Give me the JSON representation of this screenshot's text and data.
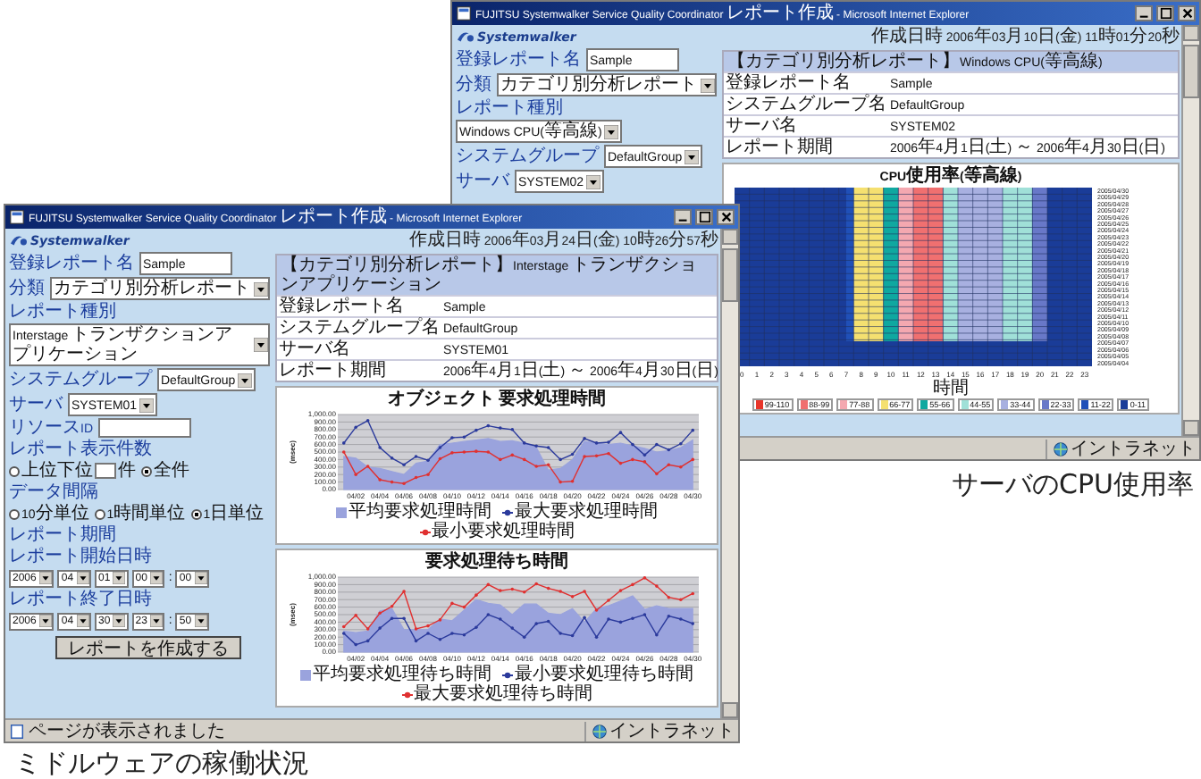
{
  "cpu_report_window": {
    "title": "FUJITSU Systemwalker Service Quality Coordinator レポート作成 - Microsoft Internet Explorer",
    "logo": "Systemwalker",
    "created": "作成日時 2006年03月10日(金) 11時01分20秒",
    "form": [
      {
        "kind": "label",
        "text": "登録レポート名"
      },
      {
        "kind": "field",
        "value": "Sample"
      },
      {
        "kind": "label",
        "text": "分類"
      },
      {
        "kind": "select",
        "value": "カテゴリ別分析レポート"
      },
      {
        "kind": "label",
        "text": "レポート種別"
      },
      {
        "kind": "select",
        "value": "Windows CPU(等高線)"
      },
      {
        "kind": "label",
        "text": "システムグループ"
      },
      {
        "kind": "select",
        "value": "DefaultGroup"
      },
      {
        "kind": "label",
        "text": "サーバ"
      },
      {
        "kind": "select",
        "value": "SYSTEM02"
      }
    ],
    "report_header": "【カテゴリ別分析レポート】Windows CPU(等高線)",
    "info_rows": [
      {
        "name": "登録レポート名",
        "value": "Sample"
      },
      {
        "name": "システムグループ名",
        "value": "DefaultGroup"
      },
      {
        "name": "サーバ名",
        "value": "SYSTEM02"
      },
      {
        "name": "レポート期間",
        "value": "2006年4月1日(土) ～ 2006年4月30日(日)"
      }
    ],
    "cpu_chart": {
      "title": "CPU使用率(等高線)",
      "xlabel": "時間",
      "x_labels": [
        "0",
        "1",
        "2",
        "3",
        "4",
        "5",
        "6",
        "7",
        "8",
        "9",
        "10",
        "11",
        "12",
        "13",
        "14",
        "15",
        "16",
        "17",
        "18",
        "19",
        "20",
        "21",
        "22",
        "23"
      ],
      "y_labels": [
        "2005/04/30",
        "2005/04/29",
        "2005/04/28",
        "2005/04/27",
        "2005/04/26",
        "2005/04/25",
        "2005/04/24",
        "2005/04/23",
        "2005/04/22",
        "2005/04/21",
        "2005/04/20",
        "2005/04/19",
        "2005/04/18",
        "2005/04/17",
        "2005/04/16",
        "2005/04/15",
        "2005/04/14",
        "2005/04/13",
        "2005/04/12",
        "2005/04/11",
        "2005/04/10",
        "2005/04/09",
        "2005/04/08",
        "2005/04/07",
        "2005/04/06",
        "2005/04/05",
        "2005/04/04"
      ],
      "legend": [
        {
          "label": "99-110",
          "color": "#e8352a"
        },
        {
          "label": "88-99",
          "color": "#f07070"
        },
        {
          "label": "77-88",
          "color": "#f4a8b0"
        },
        {
          "label": "66-77",
          "color": "#f5e070"
        },
        {
          "label": "55-66",
          "color": "#10a8a0"
        },
        {
          "label": "44-55",
          "color": "#a0e0d8"
        },
        {
          "label": "33-44",
          "color": "#a8b0e0"
        },
        {
          "label": "22-33",
          "color": "#6878c8"
        },
        {
          "label": "11-22",
          "color": "#2050b8"
        },
        {
          "label": "0-11",
          "color": "#1a3c98"
        }
      ]
    },
    "status": {
      "zone": "イントラネット"
    }
  },
  "middleware_report_window": {
    "title": "FUJITSU Systemwalker Service Quality Coordinator レポート作成 - Microsoft Internet Explorer",
    "logo": "Systemwalker",
    "created": "作成日時 2006年03月24日(金) 10時26分57秒",
    "form": [
      {
        "kind": "label",
        "text": "登録レポート名"
      },
      {
        "kind": "field",
        "value": "Sample"
      },
      {
        "kind": "label",
        "text": "分類"
      },
      {
        "kind": "select",
        "value": "カテゴリ別分析レポート"
      },
      {
        "kind": "label",
        "text": "レポート種別"
      },
      {
        "kind": "select",
        "value": "Interstage トランザクションアプリケーション"
      },
      {
        "kind": "label",
        "text": "システムグループ"
      },
      {
        "kind": "select",
        "value": "DefaultGroup"
      },
      {
        "kind": "label",
        "text": "サーバ"
      },
      {
        "kind": "select",
        "value": "SYSTEM01"
      },
      {
        "kind": "label",
        "text": "リソースID"
      },
      {
        "kind": "field"
      },
      {
        "kind": "label",
        "text": "レポート表示件数"
      },
      {
        "kind": "radio_group",
        "options": [
          {
            "label": "上位下位",
            "selected": false,
            "unit": "件"
          },
          {
            "label": "全件",
            "selected": true
          }
        ]
      },
      {
        "kind": "label",
        "text": "データ間隔"
      },
      {
        "kind": "radio_group",
        "options": [
          {
            "label": "10分単位",
            "selected": false
          },
          {
            "label": "1時間単位",
            "selected": false
          },
          {
            "label": "1日単位",
            "selected": true
          }
        ]
      },
      {
        "kind": "label",
        "text": "レポート期間"
      },
      {
        "kind": "label",
        "text": "レポート開始日時"
      },
      {
        "kind": "datetime",
        "parts": [
          "2006",
          "04",
          "01",
          "00",
          "00"
        ],
        "separator": ":"
      },
      {
        "kind": "label",
        "text": "レポート終了日時"
      },
      {
        "kind": "datetime",
        "parts": [
          "2006",
          "04",
          "30",
          "23",
          "50"
        ],
        "separator": ":"
      },
      {
        "kind": "button",
        "text": "レポートを作成する"
      }
    ],
    "report_header": "【カテゴリ別分析レポート】Interstage トランザクションアプリケーション",
    "info_rows": [
      {
        "name": "登録レポート名",
        "value": "Sample"
      },
      {
        "name": "システムグループ名",
        "value": "DefaultGroup"
      },
      {
        "name": "サーバ名",
        "value": "SYSTEM01"
      },
      {
        "name": "レポート期間",
        "value": "2006年4月1日(土) ～ 2006年4月30日(日)"
      }
    ],
    "charts": [
      {
        "chart_data": {
          "type": "line",
          "title": "オブジェクト 要求処理時間",
          "ylabel": "(msec)",
          "ylim": [
            0,
            1000
          ],
          "grid": true,
          "legend": "bottom",
          "yticks": [
            {
              "value": 0,
              "label": "0.00"
            },
            {
              "value": 100,
              "label": "100.00"
            },
            {
              "value": 200,
              "label": "200.00"
            },
            {
              "value": 300,
              "label": "300.00"
            },
            {
              "value": 400,
              "label": "400.00"
            },
            {
              "value": 500,
              "label": "500.00"
            },
            {
              "value": 600,
              "label": "600.00"
            },
            {
              "value": 700,
              "label": "700.00"
            },
            {
              "value": 800,
              "label": "800.00"
            },
            {
              "value": 900,
              "label": "900.00"
            },
            {
              "value": 1000,
              "label": "1,000.00"
            }
          ],
          "categories": [
            null,
            "04/02",
            null,
            "04/04",
            null,
            "04/06",
            null,
            "04/08",
            null,
            "04/10",
            null,
            "04/12",
            null,
            "04/14",
            null,
            "04/16",
            null,
            "04/18",
            null,
            "04/20",
            null,
            "04/22",
            null,
            "04/24",
            null,
            "04/26",
            null,
            "04/28",
            null,
            "04/30"
          ],
          "series": [
            {
              "name": "平均要求処理時間",
              "type": "area",
              "color": "#9aa3dd",
              "values": [
                440,
                420,
                300,
                280,
                240,
                200,
                350,
                380,
                600,
                620,
                640,
                660,
                680,
                640,
                650,
                620,
                560,
                260,
                280,
                400,
                640,
                620,
                600,
                620,
                580,
                550,
                500,
                520,
                560,
                660
              ]
            },
            {
              "name": "最大要求処理時間",
              "type": "line",
              "color": "#2b3a9c",
              "values": [
                620,
                830,
                920,
                560,
                420,
                330,
                440,
                390,
                560,
                690,
                700,
                790,
                850,
                820,
                800,
                620,
                580,
                560,
                400,
                470,
                680,
                620,
                630,
                760,
                600,
                460,
                600,
                530,
                610,
                790
              ]
            },
            {
              "name": "最小要求処理時間",
              "type": "line",
              "color": "#e03030",
              "values": [
                500,
                200,
                310,
                130,
                100,
                80,
                160,
                200,
                410,
                490,
                500,
                510,
                500,
                400,
                460,
                400,
                310,
                330,
                100,
                110,
                440,
                450,
                480,
                350,
                400,
                370,
                210,
                330,
                300,
                400
              ]
            }
          ]
        }
      },
      {
        "chart_data": {
          "type": "line",
          "title": "要求処理待ち時間",
          "ylabel": "(msec)",
          "ylim": [
            0,
            1000
          ],
          "grid": true,
          "legend": "bottom",
          "yticks": [
            {
              "value": 0,
              "label": "0.00"
            },
            {
              "value": 100,
              "label": "100.00"
            },
            {
              "value": 200,
              "label": "200.00"
            },
            {
              "value": 300,
              "label": "300.00"
            },
            {
              "value": 400,
              "label": "400.00"
            },
            {
              "value": 500,
              "label": "500.00"
            },
            {
              "value": 600,
              "label": "600.00"
            },
            {
              "value": 700,
              "label": "700.00"
            },
            {
              "value": 800,
              "label": "800.00"
            },
            {
              "value": 900,
              "label": "900.00"
            },
            {
              "value": 1000,
              "label": "1,000.00"
            }
          ],
          "categories": [
            null,
            "04/02",
            null,
            "04/04",
            null,
            "04/06",
            null,
            "04/08",
            null,
            "04/10",
            null,
            "04/12",
            null,
            "04/14",
            null,
            "04/16",
            null,
            "04/18",
            null,
            "04/20",
            null,
            "04/22",
            null,
            "04/24",
            null,
            "04/26",
            null,
            "04/28",
            null,
            "04/30"
          ],
          "series": [
            {
              "name": "平均要求処理待ち時間",
              "type": "area",
              "color": "#9aa3dd",
              "values": [
                280,
                260,
                280,
                550,
                580,
                300,
                300,
                300,
                440,
                420,
                560,
                700,
                650,
                630,
                500,
                640,
                640,
                520,
                500,
                580,
                400,
                580,
                620,
                680,
                750,
                570,
                620,
                580,
                580,
                580
              ]
            },
            {
              "name": "最小要求処理待ち時間",
              "type": "line",
              "color": "#2b3a9c",
              "values": [
                250,
                100,
                150,
                320,
                450,
                450,
                150,
                250,
                170,
                250,
                230,
                330,
                500,
                440,
                320,
                200,
                380,
                410,
                250,
                220,
                460,
                200,
                440,
                400,
                450,
                500,
                230,
                480,
                440,
                380
              ]
            },
            {
              "name": "最大要求処理待ち時間",
              "type": "line",
              "color": "#e03030",
              "values": [
                340,
                490,
                310,
                520,
                610,
                810,
                310,
                350,
                430,
                650,
                600,
                760,
                900,
                820,
                840,
                800,
                910,
                850,
                810,
                740,
                810,
                560,
                690,
                820,
                900,
                990,
                880,
                730,
                700,
                780
              ]
            }
          ]
        }
      }
    ],
    "status": {
      "text": "ページが表示されました",
      "zone": "イントラネット"
    }
  },
  "captions": [
    "サーバのCPU使用率",
    "ミドルウェアの稼働状況"
  ]
}
